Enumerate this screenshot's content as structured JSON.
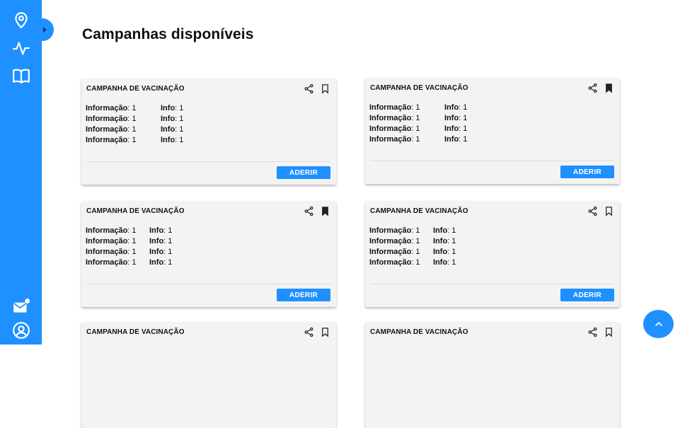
{
  "page": {
    "title": "Campanhas disponíveis"
  },
  "sidebar": {
    "items": [
      {
        "icon": "location-pin-icon"
      },
      {
        "icon": "activity-icon"
      },
      {
        "icon": "book-icon"
      }
    ],
    "bottom_items": [
      {
        "icon": "mail-notification-icon"
      },
      {
        "icon": "user-account-icon"
      }
    ]
  },
  "colors": {
    "accent": "#1e90ff",
    "card_bg": "#f3f3f3"
  },
  "cards": [
    {
      "title": "CAMPANHA DE VACINAÇÃO",
      "bookmarked": false,
      "left_rows": [
        {
          "label": "Informação",
          "value": ": 1"
        },
        {
          "label": "Informação",
          "value": ": 1"
        },
        {
          "label": "Informação",
          "value": ": 1"
        },
        {
          "label": "Informação",
          "value": ": 1"
        }
      ],
      "right_rows": [
        {
          "label": "Info",
          "value": ": 1"
        },
        {
          "label": "Info",
          "value": ": 1"
        },
        {
          "label": "Info",
          "value": ": 1"
        },
        {
          "label": "Info",
          "value": ": 1"
        }
      ],
      "button": "ADERIR"
    },
    {
      "title": "CAMPANHA DE VACINAÇÃO",
      "bookmarked": true,
      "left_rows": [
        {
          "label": "Informação",
          "value": ": 1"
        },
        {
          "label": "Informação",
          "value": ": 1"
        },
        {
          "label": "Informação",
          "value": ": 1"
        },
        {
          "label": "Informação",
          "value": ": 1"
        }
      ],
      "right_rows": [
        {
          "label": "Info",
          "value": ": 1"
        },
        {
          "label": "Info",
          "value": ": 1"
        },
        {
          "label": "Info",
          "value": ": 1"
        },
        {
          "label": "Info",
          "value": ": 1"
        }
      ],
      "button": "ADERIR"
    },
    {
      "title": "CAMPANHA DE VACINAÇÃO",
      "bookmarked": true,
      "left_rows": [
        {
          "label": "Informação",
          "value": ": 1"
        },
        {
          "label": "Informação",
          "value": ": 1"
        },
        {
          "label": "Informação",
          "value": ": 1"
        },
        {
          "label": "Informação",
          "value": ": 1"
        }
      ],
      "right_rows": [
        {
          "label": "Info",
          "value": ": 1"
        },
        {
          "label": "Info",
          "value": ": 1"
        },
        {
          "label": "Info",
          "value": ": 1"
        },
        {
          "label": "Info",
          "value": ": 1"
        }
      ],
      "button": "ADERIR"
    },
    {
      "title": "CAMPANHA DE VACINAÇÃO",
      "bookmarked": false,
      "left_rows": [
        {
          "label": "Informação",
          "value": ": 1"
        },
        {
          "label": "Informação",
          "value": ": 1"
        },
        {
          "label": "Informação",
          "value": ": 1"
        },
        {
          "label": "Informação",
          "value": ": 1"
        }
      ],
      "right_rows": [
        {
          "label": "Info",
          "value": ": 1"
        },
        {
          "label": "Info",
          "value": ": 1"
        },
        {
          "label": "Info",
          "value": ": 1"
        },
        {
          "label": "Info",
          "value": ": 1"
        }
      ],
      "button": "ADERIR"
    },
    {
      "title": "CAMPANHA DE VACINAÇÃO",
      "bookmarked": false
    },
    {
      "title": "CAMPANHA DE VACINAÇÃO",
      "bookmarked": false
    }
  ],
  "fab": {
    "icon": "chevron-up-icon"
  }
}
